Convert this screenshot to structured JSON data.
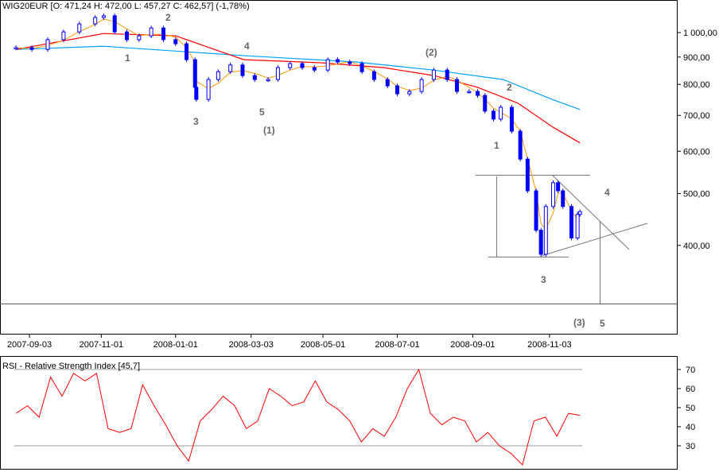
{
  "header": {
    "title": "WIG20EUR [O: 471,24  H: 472,00  L: 457,27  C: 462,57] (-1,78%)"
  },
  "rsi_panel": {
    "title": "RSI - Relative Strength Index [45,7]"
  },
  "wave_labels": [
    "1",
    "2",
    "3",
    "4",
    "5",
    "(1)",
    "(2)",
    "2",
    "1",
    "3",
    "4",
    "(3)",
    "5"
  ],
  "colors": {
    "candles": "#0000ff",
    "ma_long": "#00a0ff",
    "ma_mid": "#ff0000",
    "ma_short": "#ff9900",
    "rsi": "#ff0000",
    "lines": "#808080"
  },
  "chart_data": [
    {
      "type": "line",
      "title": "WIG20EUR",
      "scale": "log",
      "ylim": [
        330,
        1110
      ],
      "y_ticks": [
        {
          "v": 1000,
          "label": "1 000,00"
        },
        {
          "v": 900,
          "label": "900,00"
        },
        {
          "v": 800,
          "label": "800,00"
        },
        {
          "v": 700,
          "label": "700,00"
        },
        {
          "v": 600,
          "label": "600,00"
        },
        {
          "v": 500,
          "label": "500,00"
        },
        {
          "v": 400,
          "label": "400,00"
        }
      ],
      "x_ticks": [
        "2007-09-03",
        "2007-11-01",
        "2008-01-01",
        "2008-03-03",
        "2008-05-01",
        "2008-07-01",
        "2008-09-01",
        "2008-11-03"
      ],
      "close": [
        [
          "2007-08-23",
          937
        ],
        [
          "2007-09-05",
          930
        ],
        [
          "2007-09-18",
          970
        ],
        [
          "2007-10-01",
          1003
        ],
        [
          "2007-10-14",
          1038
        ],
        [
          "2007-10-27",
          1067
        ],
        [
          "2007-11-03",
          1075
        ],
        [
          "2007-11-12",
          1003
        ],
        [
          "2007-11-22",
          970
        ],
        [
          "2007-12-02",
          986
        ],
        [
          "2007-12-12",
          1020
        ],
        [
          "2007-12-22",
          970
        ],
        [
          "2008-01-01",
          953
        ],
        [
          "2008-01-10",
          890
        ],
        [
          "2008-01-17",
          790
        ],
        [
          "2008-01-18",
          750
        ],
        [
          "2008-01-28",
          817
        ],
        [
          "2008-02-05",
          845
        ],
        [
          "2008-02-15",
          870
        ],
        [
          "2008-02-25",
          831
        ],
        [
          "2008-03-06",
          817
        ],
        [
          "2008-03-17",
          817
        ],
        [
          "2008-03-25",
          860
        ],
        [
          "2008-04-04",
          875
        ],
        [
          "2008-04-14",
          860
        ],
        [
          "2008-04-24",
          851
        ],
        [
          "2008-05-05",
          890
        ],
        [
          "2008-05-13",
          881
        ],
        [
          "2008-05-23",
          875
        ],
        [
          "2008-06-02",
          845
        ],
        [
          "2008-06-12",
          817
        ],
        [
          "2008-06-23",
          795
        ],
        [
          "2008-07-01",
          768
        ],
        [
          "2008-07-11",
          776
        ],
        [
          "2008-07-21",
          817
        ],
        [
          "2008-07-31",
          851
        ],
        [
          "2008-08-11",
          817
        ],
        [
          "2008-08-19",
          776
        ],
        [
          "2008-08-29",
          776
        ],
        [
          "2008-09-05",
          763
        ],
        [
          "2008-09-11",
          713
        ],
        [
          "2008-09-18",
          689
        ],
        [
          "2008-09-24",
          725
        ],
        [
          "2008-10-03",
          654
        ],
        [
          "2008-10-10",
          580
        ],
        [
          "2008-10-16",
          506
        ],
        [
          "2008-10-23",
          427
        ],
        [
          "2008-10-27",
          385
        ],
        [
          "2008-10-31",
          473
        ],
        [
          "2008-11-06",
          524
        ],
        [
          "2008-11-10",
          506
        ],
        [
          "2008-11-14",
          473
        ],
        [
          "2008-11-21",
          413
        ],
        [
          "2008-11-26",
          457
        ],
        [
          "2008-11-28",
          462.57
        ]
      ],
      "ma_long": [
        [
          "2007-08-23",
          930
        ],
        [
          "2007-11-03",
          943
        ],
        [
          "2008-02-28",
          905
        ],
        [
          "2008-05-28",
          881
        ],
        [
          "2008-07-31",
          851
        ],
        [
          "2008-09-26",
          817
        ],
        [
          "2008-11-05",
          750
        ],
        [
          "2008-11-28",
          718
        ]
      ],
      "ma_mid": [
        [
          "2007-08-23",
          930
        ],
        [
          "2007-11-03",
          996
        ],
        [
          "2008-01-01",
          986
        ],
        [
          "2008-02-26",
          890
        ],
        [
          "2008-04-29",
          878
        ],
        [
          "2008-06-20",
          860
        ],
        [
          "2008-07-31",
          831
        ],
        [
          "2008-09-05",
          790
        ],
        [
          "2008-10-08",
          738
        ],
        [
          "2008-11-06",
          665
        ],
        [
          "2008-11-28",
          622
        ]
      ]
    },
    {
      "type": "line",
      "title": "RSI - Relative Strength Index [45,7]",
      "ylim": [
        18,
        75
      ],
      "y_ticks": [
        70,
        60,
        50,
        40,
        30
      ],
      "reference_lines": [
        70,
        30
      ],
      "x_range": [
        "2007-08-23",
        "2008-11-28"
      ],
      "values": [
        47,
        51,
        45,
        66,
        56,
        68,
        64,
        68,
        39,
        37,
        39,
        62,
        51,
        41,
        30,
        22,
        43,
        49,
        56,
        51,
        39,
        43,
        60,
        56,
        51,
        53,
        64,
        53,
        49,
        43,
        32,
        39,
        35,
        45,
        60,
        70,
        47,
        41,
        45,
        43,
        32,
        37,
        30,
        26,
        20,
        43,
        45,
        35,
        47,
        46
      ]
    }
  ]
}
